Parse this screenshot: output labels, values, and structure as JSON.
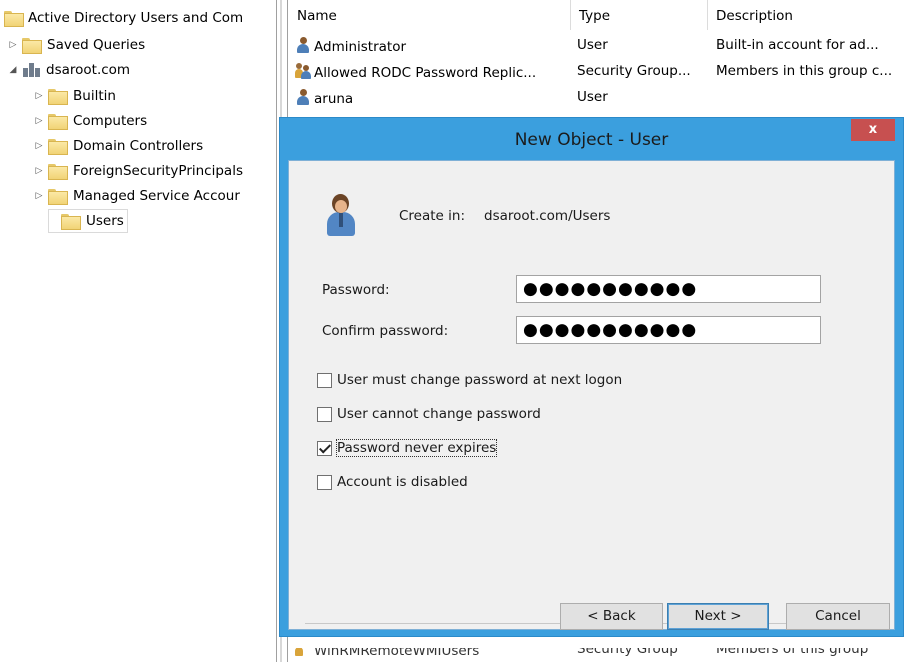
{
  "tree": {
    "root_label": "Active Directory Users and Com",
    "items": [
      {
        "label": "Saved Queries"
      },
      {
        "label": "dsaroot.com"
      },
      {
        "label": "Builtin"
      },
      {
        "label": "Computers"
      },
      {
        "label": "Domain Controllers"
      },
      {
        "label": "ForeignSecurityPrincipals"
      },
      {
        "label": "Managed Service Accour"
      },
      {
        "label": "Users"
      }
    ]
  },
  "list": {
    "columns": [
      "Name",
      "Type",
      "Description"
    ],
    "rows": [
      {
        "name": "Administrator",
        "type": "User",
        "description": "Built-in account for ad..."
      },
      {
        "name": "Allowed RODC Password Replic...",
        "type": "Security Group...",
        "description": "Members in this group c..."
      },
      {
        "name": "aruna",
        "type": "User",
        "description": ""
      }
    ],
    "footer_row": {
      "name": "WinRMRemoteWMIUsers",
      "type": "Security Group",
      "description": "Members of this group"
    }
  },
  "dialog": {
    "title": "New Object - User",
    "close_label": "x",
    "create_in_label": "Create in:",
    "create_in_value": "dsaroot.com/Users",
    "password_label": "Password:",
    "password_value": "●●●●●●●●●●●",
    "confirm_label": "Confirm password:",
    "confirm_value": "●●●●●●●●●●●",
    "checkboxes": [
      {
        "label": "User must change password at next logon",
        "checked": false
      },
      {
        "label": "User cannot change password",
        "checked": false
      },
      {
        "label": "Password never expires",
        "checked": true
      },
      {
        "label": "Account is disabled",
        "checked": false
      }
    ],
    "buttons": {
      "back": "< Back",
      "next": "Next >",
      "cancel": "Cancel"
    }
  }
}
